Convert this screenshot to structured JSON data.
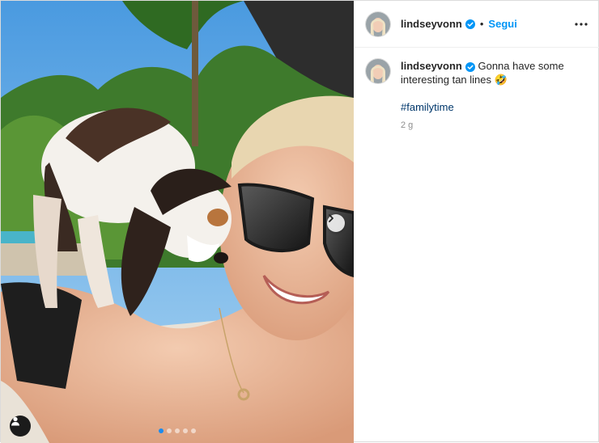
{
  "post": {
    "username": "lindseyvonn",
    "follow_label": "Segui",
    "separator": "•",
    "caption": "Gonna have some interesting tan lines 🤣",
    "hashtag": "#familytime",
    "time_ago": "2 g",
    "carousel": {
      "total": 5,
      "active_index": 1
    }
  },
  "icons": {
    "verified": "verified-badge-icon",
    "more": "more-options-icon",
    "next": "chevron-right-icon",
    "user_tag": "user-tag-icon"
  },
  "colors": {
    "accent": "#0095f6",
    "verified": "#0095f6",
    "hashtag": "#00376b",
    "muted": "#8e8e8e"
  }
}
